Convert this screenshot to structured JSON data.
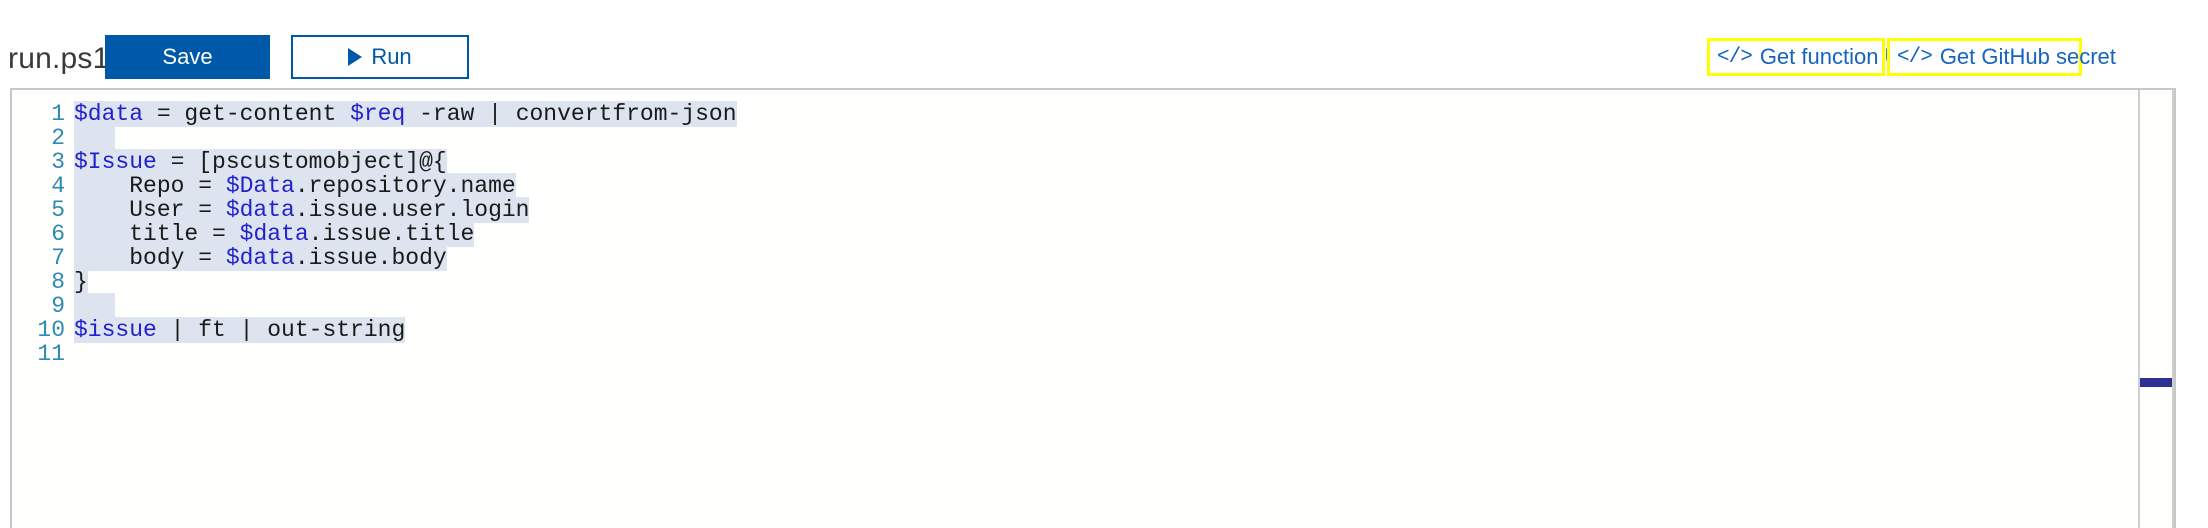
{
  "header": {
    "filename": "run.ps1",
    "save_label": "Save",
    "run_label": "Run",
    "play_icon": "play-triangle-icon",
    "links": [
      {
        "glyph": "</>",
        "label": "Get function URL",
        "icon": "code-brackets-icon",
        "highlight_color": "#ffff00",
        "text_color": "#1565c0"
      },
      {
        "glyph": "</>",
        "label": "Get GitHub secret",
        "icon": "code-brackets-icon",
        "highlight_color": "#ffff00",
        "text_color": "#1565c0"
      }
    ],
    "save_bg": "#0058a8",
    "run_border": "#0058a8"
  },
  "editor": {
    "language": "powershell",
    "line_number_color": "#2e8ab0",
    "selection_color": "#dde4ef",
    "variable_color": "#2222cc",
    "text_color": "#1a1a1a",
    "line_numbers": [
      "1",
      "2",
      "3",
      "4",
      "5",
      "6",
      "7",
      "8",
      "9",
      "10",
      "11"
    ],
    "lines": [
      {
        "n": "1",
        "selected": true,
        "tokens": [
          {
            "t": "$data",
            "k": "var"
          },
          {
            "t": " = get-content ",
            "k": "plain"
          },
          {
            "t": "$req",
            "k": "var"
          },
          {
            "t": " -raw | convertfrom-json",
            "k": "plain"
          }
        ]
      },
      {
        "n": "2",
        "selected": true,
        "tokens": [
          {
            "t": "",
            "k": "plain"
          }
        ]
      },
      {
        "n": "3",
        "selected": true,
        "tokens": [
          {
            "t": "$Issue",
            "k": "var"
          },
          {
            "t": " = [pscustomobject]@{",
            "k": "plain"
          }
        ]
      },
      {
        "n": "4",
        "selected": true,
        "tokens": [
          {
            "t": "    Repo = ",
            "k": "plain"
          },
          {
            "t": "$Data",
            "k": "var"
          },
          {
            "t": ".repository.name",
            "k": "plain"
          }
        ]
      },
      {
        "n": "5",
        "selected": true,
        "tokens": [
          {
            "t": "    User = ",
            "k": "plain"
          },
          {
            "t": "$data",
            "k": "var"
          },
          {
            "t": ".issue.user.login",
            "k": "plain"
          }
        ]
      },
      {
        "n": "6",
        "selected": true,
        "tokens": [
          {
            "t": "    title = ",
            "k": "plain"
          },
          {
            "t": "$data",
            "k": "var"
          },
          {
            "t": ".issue.title",
            "k": "plain"
          }
        ]
      },
      {
        "n": "7",
        "selected": true,
        "tokens": [
          {
            "t": "    body = ",
            "k": "plain"
          },
          {
            "t": "$data",
            "k": "var"
          },
          {
            "t": ".issue.body",
            "k": "plain"
          }
        ]
      },
      {
        "n": "8",
        "selected": true,
        "tokens": [
          {
            "t": "}",
            "k": "plain"
          }
        ]
      },
      {
        "n": "9",
        "selected": true,
        "tokens": [
          {
            "t": "",
            "k": "plain"
          }
        ]
      },
      {
        "n": "10",
        "selected": true,
        "tokens": [
          {
            "t": "$issue",
            "k": "var"
          },
          {
            "t": " | ft | out-string",
            "k": "plain"
          }
        ]
      },
      {
        "n": "11",
        "selected": false,
        "tokens": [
          {
            "t": "",
            "k": "plain"
          }
        ]
      }
    ],
    "scrollbar": {
      "marker_color": "#2e3192",
      "marker_name": "scroll-position-marker"
    }
  }
}
